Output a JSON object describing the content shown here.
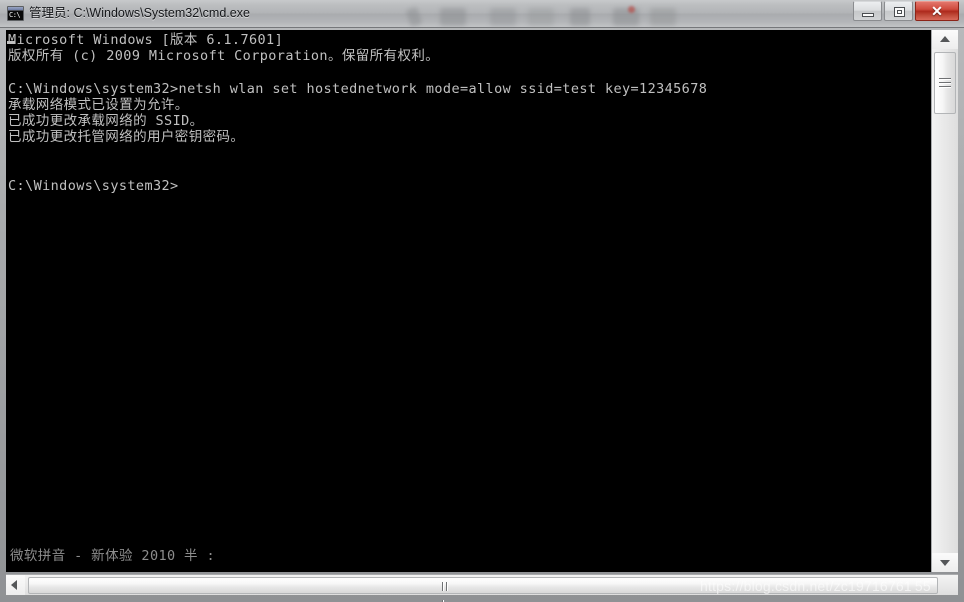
{
  "window": {
    "title": "管理员: C:\\Windows\\System32\\cmd.exe",
    "icon_label": "C:\\",
    "icon_name": "cmd-console-icon"
  },
  "caption_buttons": {
    "minimize_label": "—",
    "maximize_label": "❐",
    "close_label": "✕",
    "close_color": "#ad2a1d"
  },
  "console": {
    "background": "#000000",
    "foreground": "#c0c0c0",
    "lines": "Microsoft Windows [版本 6.1.7601]\n版权所有 (c) 2009 Microsoft Corporation。保留所有权利。\n\nC:\\Windows\\system32>netsh wlan set hostednetwork mode=allow ssid=test key=12345678\n承载网络模式已设置为允许。\n已成功更改承载网络的 SSID。\n已成功更改托管网络的用户密钥密码。\n\n\nC:\\Windows\\system32>",
    "prompt": "C:\\Windows\\system32>",
    "command": "netsh wlan set hostednetwork mode=allow ssid=test key=12345678",
    "output": [
      "承载网络模式已设置为允许。",
      "已成功更改承载网络的 SSID。",
      "已成功更改托管网络的用户密钥密码。"
    ],
    "header": [
      "Microsoft Windows [版本 6.1.7601]",
      "版权所有 (c) 2009 Microsoft Corporation。保留所有权利。"
    ],
    "ime_status": "微软拼音 - 新体验 2010 半 :"
  },
  "scrollbars": {
    "vertical_up_icon": "triangle-up-icon",
    "vertical_down_icon": "triangle-down-icon",
    "horizontal_left_icon": "triangle-left-icon"
  },
  "watermark": {
    "text": "https://blog.csdn.net/zc19716761 55"
  }
}
